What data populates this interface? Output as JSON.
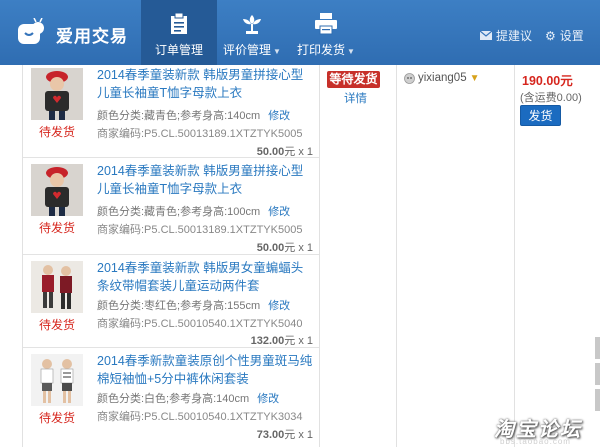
{
  "header": {
    "logo_text": "爱用交易",
    "nav": [
      {
        "label": "订单管理",
        "active": true
      },
      {
        "label": "评价管理",
        "active": false
      },
      {
        "label": "打印发货",
        "active": false
      }
    ],
    "suggest_label": "提建议",
    "settings_label": "设置"
  },
  "order": {
    "status_badge": "等待发货",
    "detail_link": "详情",
    "buyer": "yixiang05",
    "total": "190.00元",
    "shipping_note": "(含运费0.00)",
    "ship_button": "发货"
  },
  "items": [
    {
      "status": "待发货",
      "title": "2014春季童装新款 韩版男童拼接心型儿童长袖童T恤字母款上衣",
      "sku": "颜色分类:藏青色;参考身高:140cm",
      "edit_label": "修改",
      "code": "商家编码:P5.CL.50013189.1XTZTYK5005",
      "price": "50.00",
      "unit": "元 x 1"
    },
    {
      "status": "待发货",
      "title": "2014春季童装新款 韩版男童拼接心型儿童长袖童T恤字母款上衣",
      "sku": "颜色分类:藏青色;参考身高:100cm",
      "edit_label": "修改",
      "code": "商家编码:P5.CL.50013189.1XTZTYK5005",
      "price": "50.00",
      "unit": "元 x 1"
    },
    {
      "status": "待发货",
      "title": "2014春季童装新款 韩版男女童蝙蝠头条纹带帽套装儿童运动两件套",
      "sku": "颜色分类:枣红色;参考身高:155cm",
      "edit_label": "修改",
      "code": "商家编码:P5.CL.50010540.1XTZTYK5040",
      "price": "132.00",
      "unit": "元 x 1"
    },
    {
      "status": "待发货",
      "title": "2014春季新款童装原创个性男童斑马纯棉短袖恤+5分中裤休闲套装",
      "sku": "颜色分类:白色;参考身高:140cm",
      "edit_label": "修改",
      "code": "商家编码:P5.CL.50010540.1XTZTYK3034",
      "price": "73.00",
      "unit": "元 x 1"
    }
  ],
  "watermark": {
    "text": "淘宝论坛",
    "sub": "bbs.taobao.com"
  },
  "colors": {
    "header_bg": "#3574bb",
    "active_nav": "#255a96",
    "link": "#2a79c0",
    "alert": "#d6261e",
    "button": "#1b6bc0"
  }
}
